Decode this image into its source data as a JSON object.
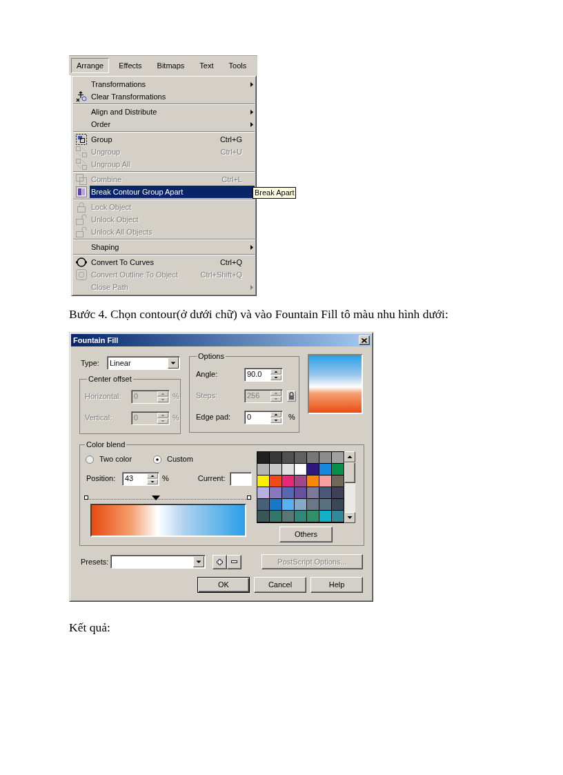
{
  "menu_screenshot": {
    "menu_bar": [
      {
        "label": "Arrange",
        "selected": true
      },
      {
        "label": "Effects",
        "selected": false
      },
      {
        "label": "Bitmaps",
        "selected": false
      },
      {
        "label": "Text",
        "selected": false
      },
      {
        "label": "Tools",
        "selected": false
      }
    ],
    "menu_sections": [
      [
        {
          "label": "Transformations",
          "submenu": true,
          "disabled": false,
          "selected": false
        },
        {
          "label": "Clear Transformations",
          "submenu": false,
          "disabled": false,
          "selected": false
        }
      ],
      [
        {
          "label": "Align and Distribute",
          "submenu": true,
          "disabled": false,
          "selected": false
        },
        {
          "label": "Order",
          "submenu": true,
          "disabled": false,
          "selected": false
        }
      ],
      [
        {
          "label": "Group",
          "shortcut": "Ctrl+G",
          "submenu": false,
          "disabled": false,
          "selected": false
        },
        {
          "label": "Ungroup",
          "shortcut": "Ctrl+U",
          "submenu": false,
          "disabled": true,
          "selected": false
        },
        {
          "label": "Ungroup All",
          "submenu": false,
          "disabled": true,
          "selected": false
        }
      ],
      [
        {
          "label": "Combine",
          "shortcut": "Ctrl+L",
          "submenu": false,
          "disabled": true,
          "selected": false
        },
        {
          "label": "Break Contour Group Apart",
          "submenu": false,
          "disabled": false,
          "selected": true
        }
      ],
      [
        {
          "label": "Lock Object",
          "submenu": false,
          "disabled": true,
          "selected": false
        },
        {
          "label": "Unlock Object",
          "submenu": false,
          "disabled": true,
          "selected": false
        },
        {
          "label": "Unlock All Objects",
          "submenu": false,
          "disabled": true,
          "selected": false
        }
      ],
      [
        {
          "label": "Shaping",
          "submenu": true,
          "disabled": false,
          "selected": false
        }
      ],
      [
        {
          "label": "Convert To Curves",
          "shortcut": "Ctrl+Q",
          "submenu": false,
          "disabled": false,
          "selected": false
        },
        {
          "label": "Convert Outline To Object",
          "shortcut": "Ctrl+Shift+Q",
          "submenu": false,
          "disabled": true,
          "selected": false
        },
        {
          "label": "Close Path",
          "submenu": true,
          "disabled": true,
          "selected": false
        }
      ]
    ],
    "tooltip": "Break Apart"
  },
  "instruction": "Bước 4. Chọn contour(ở dưới chữ) và vào Fountain Fill tô màu nhu hình dưới:",
  "dialog": {
    "title": "Fountain Fill",
    "type_label": "Type:",
    "type_value": "Linear",
    "center_offset": {
      "title": "Center offset",
      "fields": [
        {
          "label": "Horizontal:",
          "value": "0",
          "unit": "%",
          "disabled": true
        },
        {
          "label": "Vertical:",
          "value": "0",
          "unit": "%",
          "disabled": true
        }
      ]
    },
    "options": {
      "title": "Options",
      "fields": [
        {
          "kind": "spin",
          "label": "Angle:",
          "value": "90.0",
          "disabled": false
        },
        {
          "kind": "spin_lock",
          "label": "Steps:",
          "value": "256",
          "disabled": true
        },
        {
          "kind": "spin",
          "label": "Edge pad:",
          "value": "0",
          "unit": "%",
          "disabled": false
        }
      ]
    },
    "color_blend": {
      "title": "Color blend",
      "modes": [
        {
          "label": "Two color",
          "selected": false
        },
        {
          "label": "Custom",
          "selected": true
        }
      ],
      "position_label": "Position:",
      "position_value": "43",
      "position_unit": "%",
      "current_label": "Current:",
      "slider": {
        "level": 0.43
      },
      "palette": [
        {
          "color": "#202020",
          "selected": false
        },
        {
          "color": "#383838",
          "selected": false
        },
        {
          "color": "#505050",
          "selected": false
        },
        {
          "color": "#606060",
          "selected": false
        },
        {
          "color": "#787878",
          "selected": false
        },
        {
          "color": "#8c8c8c",
          "selected": false
        },
        {
          "color": "#a0a0a0",
          "selected": false
        },
        {
          "color": "#b4b4b4",
          "selected": false
        },
        {
          "color": "#c8c8c8",
          "selected": false
        },
        {
          "color": "#e0e0e0",
          "selected": false
        },
        {
          "color": "#ffffff",
          "selected": true
        },
        {
          "color": "#301880",
          "selected": false
        },
        {
          "color": "#1888e0",
          "selected": false
        },
        {
          "color": "#08904a",
          "selected": false
        },
        {
          "color": "#f8f000",
          "selected": false
        },
        {
          "color": "#f04818",
          "selected": false
        },
        {
          "color": "#e82878",
          "selected": false
        },
        {
          "color": "#a04888",
          "selected": false
        },
        {
          "color": "#f88808",
          "selected": false
        },
        {
          "color": "#f8a0a0",
          "selected": false
        },
        {
          "color": "#706858",
          "selected": false
        },
        {
          "color": "#b8b0e0",
          "selected": false
        },
        {
          "color": "#8878c0",
          "selected": false
        },
        {
          "color": "#5868b0",
          "selected": false
        },
        {
          "color": "#6850a0",
          "selected": false
        },
        {
          "color": "#807898",
          "selected": false
        },
        {
          "color": "#485878",
          "selected": false
        },
        {
          "color": "#404058",
          "selected": false
        },
        {
          "color": "#486078",
          "selected": false
        },
        {
          "color": "#1878c8",
          "selected": false
        },
        {
          "color": "#58b0f0",
          "selected": false
        },
        {
          "color": "#88a8c8",
          "selected": false
        },
        {
          "color": "#687888",
          "selected": false
        },
        {
          "color": "#587080",
          "selected": false
        },
        {
          "color": "#384858",
          "selected": false
        },
        {
          "color": "#385858",
          "selected": false
        },
        {
          "color": "#307868",
          "selected": false
        },
        {
          "color": "#587878",
          "selected": false
        },
        {
          "color": "#308878",
          "selected": false
        },
        {
          "color": "#309068",
          "selected": false
        },
        {
          "color": "#10b0c8",
          "selected": false
        },
        {
          "color": "#308898",
          "selected": false
        }
      ],
      "others_button": "Others"
    },
    "presets_label": "Presets:",
    "postscript_button": {
      "label": "PostScript Options...",
      "disabled": true
    },
    "buttons": [
      {
        "label": "OK",
        "default": true
      },
      {
        "label": "Cancel",
        "default": false
      },
      {
        "label": "Help",
        "default": false
      }
    ]
  },
  "result_label": "Kết quả:"
}
